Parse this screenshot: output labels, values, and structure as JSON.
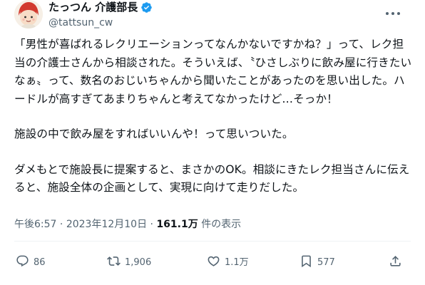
{
  "author": {
    "display_name": "たっつん 介護部長",
    "handle": "@tattsun_cw",
    "verified_color": "#1d9bf0"
  },
  "body": {
    "paragraphs": [
      "「男性が喜ばれるレクリエーションってなんかないですかね？」って、レク担当の介護士さんから相談された。そういえば、〝ひさしぶりに飲み屋に行きたいなぁ〟って、数名のおじいちゃんから聞いたことがあったのを思い出した。ハードルが高すぎてあまりちゃんと考えてなかったけど…そっか！",
      "施設の中で飲み屋をすればいいんや！って思いついた。",
      "ダメもとで施設長に提案すると、まさかのOK。相談にきたレク担当さんに伝えると、施設全体の企画として、実現に向けて走りだした。"
    ]
  },
  "meta": {
    "time": "午後6:57",
    "separator": "·",
    "date": "2023年12月10日",
    "views_count": "161.1万",
    "views_label": "件の表示"
  },
  "actions": {
    "reply_count": "86",
    "retweet_count": "1,906",
    "like_count": "1.1万",
    "views_count": "577"
  }
}
